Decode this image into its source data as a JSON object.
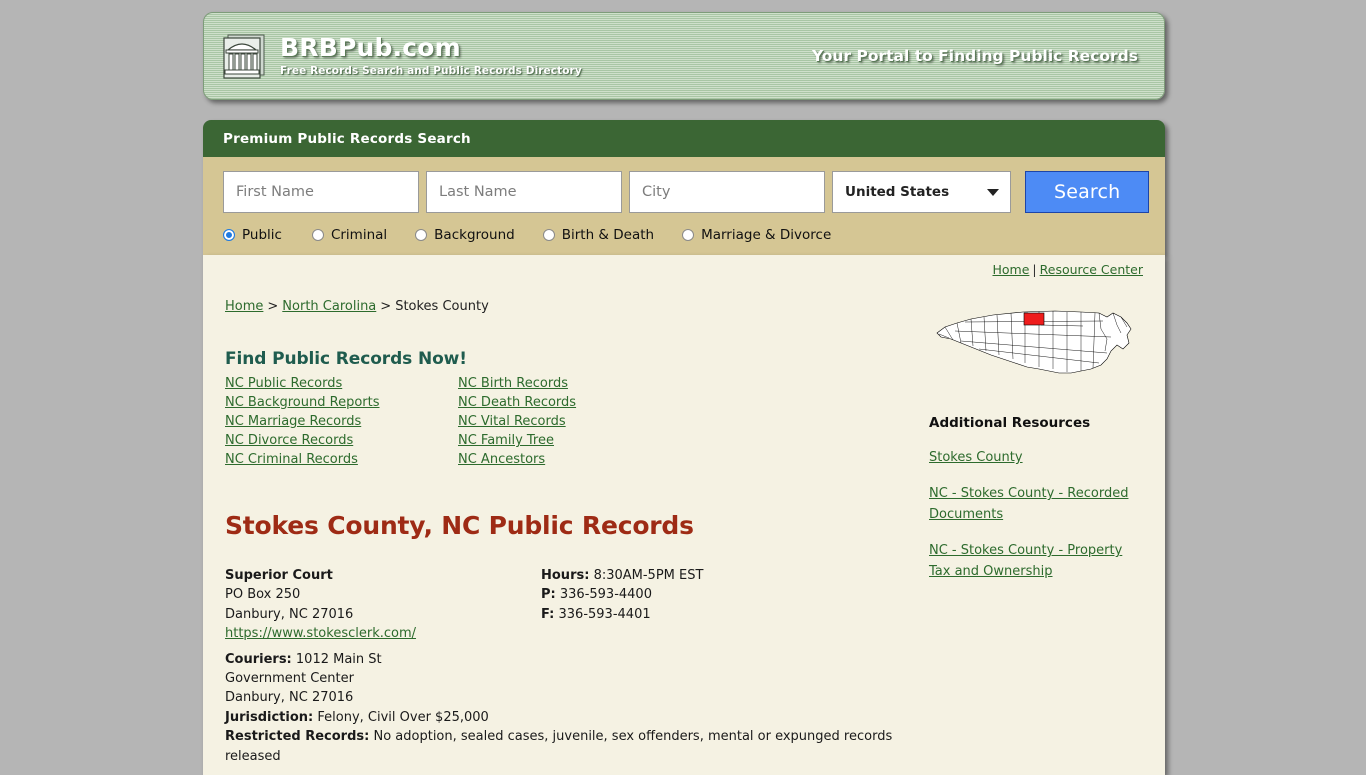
{
  "banner": {
    "logo_icon": "courthouse-icon",
    "title": "BRBPub.com",
    "subtitle": "Free Records Search and Public Records Directory",
    "tagline": "Your Portal to Finding Public Records"
  },
  "search_panel": {
    "heading": "Premium Public Records Search",
    "first_name_placeholder": "First Name",
    "first_name_value": "",
    "last_name_placeholder": "Last Name",
    "last_name_value": "",
    "city_placeholder": "City",
    "city_value": "",
    "country_selected": "United States",
    "search_button": "Search",
    "record_types": [
      {
        "label": "Public",
        "selected": true
      },
      {
        "label": "Criminal",
        "selected": false
      },
      {
        "label": "Background",
        "selected": false
      },
      {
        "label": "Birth & Death",
        "selected": false
      },
      {
        "label": "Marriage & Divorce",
        "selected": false
      }
    ]
  },
  "top_links": {
    "home": "Home",
    "separator": "|",
    "resource_center": "Resource Center"
  },
  "breadcrumb": {
    "home": "Home",
    "gt1": ">",
    "state": "North Carolina",
    "gt2": ">",
    "current": "Stokes County"
  },
  "find_records": {
    "heading": "Find Public Records Now!",
    "links": [
      "NC Public Records",
      "NC Birth Records",
      "NC Background Reports",
      "NC Death Records",
      "NC Marriage Records",
      "NC Vital Records",
      "NC Divorce Records",
      "NC Family Tree",
      "NC Criminal Records",
      "NC Ancestors"
    ]
  },
  "main": {
    "heading": "Stokes County, NC Public Records",
    "court": {
      "name": "Superior Court",
      "address_line1": "PO Box 250",
      "address_line2": "Danbury, NC 27016",
      "website": "https://www.stokesclerk.com/"
    },
    "details": {
      "hours_label": "Hours:",
      "hours_value": "8:30AM-5PM EST",
      "phone_label": "P:",
      "phone_value": "336-593-4400",
      "fax_label": "F:",
      "fax_value": "336-593-4401"
    },
    "couriers": {
      "label": "Couriers:",
      "line1": "1012 Main St",
      "line2": "Government Center",
      "line3": "Danbury, NC 27016"
    },
    "jurisdiction": {
      "label": "Jurisdiction:",
      "value": "Felony, Civil Over $25,000"
    },
    "restricted": {
      "label": "Restricted Records:",
      "value": "No adoption, sealed cases, juvenile, sex offenders, mental or expunged records released"
    }
  },
  "sidebar": {
    "map_icon": "north-carolina-county-map",
    "map_highlight_color": "#ee1c1c",
    "heading": "Additional Resources",
    "links": [
      "Stokes County",
      "NC - Stokes County - Recorded Documents",
      "NC - Stokes County - Property Tax and Ownership"
    ]
  },
  "colors": {
    "panel_green": "#3b6634",
    "panel_khaki": "#d5c694",
    "content_cream": "#f5f2e3",
    "link_green": "#2d6b2d",
    "heading_red": "#9e2b15",
    "heading_teal": "#1f5c4e",
    "button_blue": "#4d8bf5",
    "page_gray": "#b5b5b5"
  }
}
